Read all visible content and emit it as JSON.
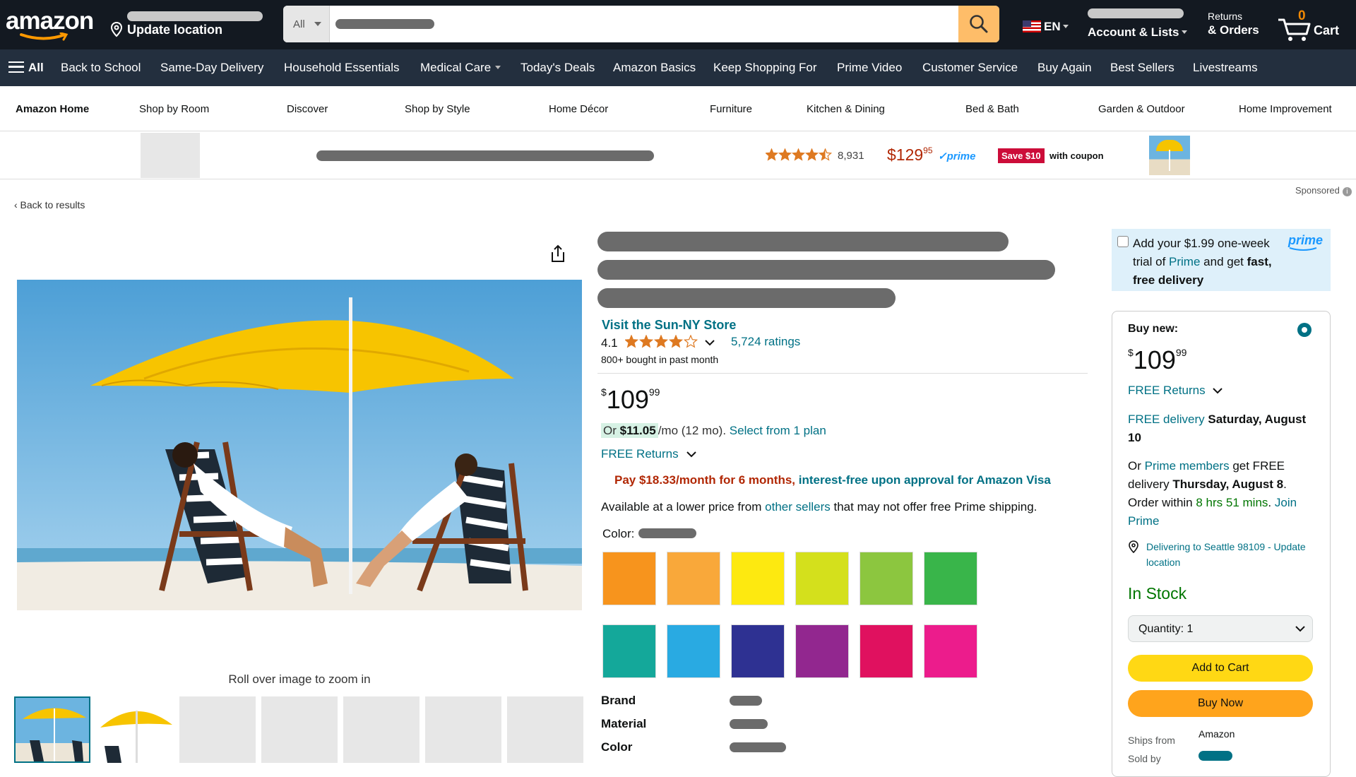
{
  "header": {
    "logo": "amazon",
    "location_label": "Update location",
    "search_category": "All",
    "language": "EN",
    "account_label": "Account & Lists",
    "returns_small": "Returns",
    "returns_big": "& Orders",
    "cart_count": "0",
    "cart_label": "Cart"
  },
  "nav": {
    "all_label": "All",
    "items": [
      "Back to School",
      "Same-Day Delivery",
      "Household Essentials",
      "Medical Care",
      "Today's Deals",
      "Amazon Basics",
      "Keep Shopping For",
      "Prime Video",
      "Customer Service",
      "Buy Again",
      "Best Sellers",
      "Livestreams"
    ]
  },
  "subnav": {
    "items": [
      "Amazon Home",
      "Shop by Room",
      "Discover",
      "Shop by Style",
      "Home Décor",
      "Furniture",
      "Kitchen & Dining",
      "Bed & Bath",
      "Garden & Outdoor",
      "Home Improvement"
    ]
  },
  "sponsored_strip": {
    "rating_count": "8,931",
    "price_whole": "$129",
    "price_cents": "95",
    "prime": "✓prime",
    "save_badge": "Save $10",
    "coupon_text": "with coupon",
    "rating": 4.5
  },
  "sponsored_label": "Sponsored",
  "back_link": "‹ Back to results",
  "gallery": {
    "zoom_hint": "Roll over image to zoom in"
  },
  "product": {
    "store_link": "Visit the Sun-NY Store",
    "rating_value": "4.1",
    "rating": 4.1,
    "ratings_count": "5,724 ratings",
    "bought": "800+ bought in past month",
    "price_symbol": "$",
    "price_whole": "109",
    "price_cents": "99",
    "finance_or": "Or",
    "finance_amount": "$11.05",
    "finance_term": "/mo (12 mo).",
    "finance_link": "Select from 1 plan",
    "free_returns": "FREE Returns",
    "visa_red": "Pay $18.33/month for 6 months,",
    "visa_teal": "interest-free upon approval for Amazon Visa",
    "lower_pre": "Available at a lower price from",
    "lower_link": "other sellers",
    "lower_post": "that may not offer free Prime shipping.",
    "color_label": "Color:",
    "swatches": [
      "#f7941d",
      "#f9a83a",
      "#fde910",
      "#d4e01c",
      "#8cc63f",
      "#39b54a",
      "#14a89a",
      "#29aae2",
      "#2e3192",
      "#92278f",
      "#e0115f",
      "#ec1c8c"
    ],
    "attributes": [
      "Brand",
      "Material",
      "Color"
    ]
  },
  "buybox": {
    "prime_trial_pre": "Add your $1.99 one-week trial of",
    "prime_trial_link": "Prime",
    "prime_trial_mid": "and get",
    "prime_trial_bold": "fast, free delivery",
    "prime_logo": "prime",
    "buy_new": "Buy new:",
    "price_symbol": "$",
    "price_whole": "109",
    "price_cents": "99",
    "free_returns": "FREE Returns",
    "free_delivery_link": "FREE delivery",
    "free_delivery_date": "Saturday, August 10",
    "or": "Or",
    "prime_members": "Prime members",
    "get_free": "get FREE delivery",
    "fast_date": "Thursday, August 8",
    "order_within": "Order within",
    "countdown": "8 hrs 51 mins",
    "join_prime": "Join Prime",
    "delivering": "Delivering to Seattle 98109 - Update location",
    "in_stock": "In Stock",
    "quantity_label": "Quantity:",
    "quantity_value": "1",
    "add_to_cart": "Add to Cart",
    "buy_now": "Buy Now",
    "ships_from_label": "Ships from",
    "ships_from_value": "Amazon",
    "sold_by_label": "Sold by"
  }
}
